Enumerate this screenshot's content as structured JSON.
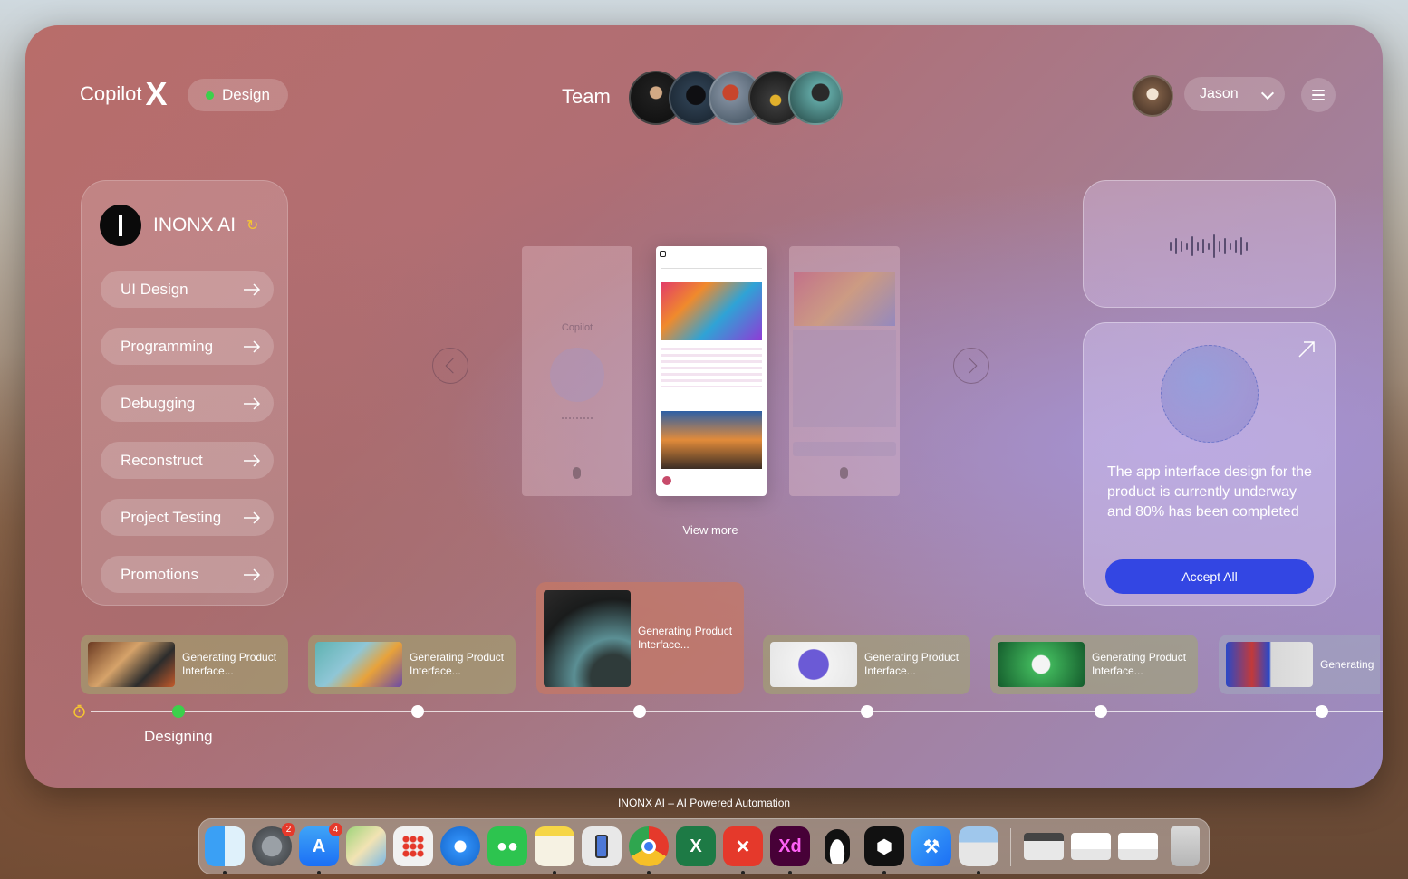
{
  "header": {
    "app_name": "Copilot",
    "app_name_suffix": "X",
    "mode_label": "Design",
    "team_label": "Team",
    "user_name": "Jason"
  },
  "sidebar": {
    "brand_name": "INONX AI",
    "items": [
      {
        "label": "UI Design"
      },
      {
        "label": "Programming"
      },
      {
        "label": "Debugging"
      },
      {
        "label": "Reconstruct"
      },
      {
        "label": "Project Testing"
      },
      {
        "label": "Promotions"
      }
    ]
  },
  "carousel": {
    "left_phone_title": "Copilot",
    "view_more_label": "View more"
  },
  "status_card": {
    "message": "The app interface design for the product is currently underway and 80% has been completed",
    "accept_label": "Accept All"
  },
  "tasks": [
    {
      "label": "Generating Product Interface..."
    },
    {
      "label": "Generating Product Interface..."
    },
    {
      "label": "Generating Product Interface..."
    },
    {
      "label": "Generating Product Interface..."
    },
    {
      "label": "Generating Product Interface..."
    },
    {
      "label": "Generating"
    }
  ],
  "timeline": {
    "current_stage_label": "Designing"
  },
  "dock": {
    "caption": "INONX AI – AI Powered Automation",
    "settings_badge": "2",
    "appstore_badge": "4",
    "icons": [
      "finder-icon",
      "settings-icon",
      "appstore-icon",
      "maps-icon",
      "launchpad-icon",
      "safari-icon",
      "wechat-icon",
      "notes-icon",
      "iphone-mirroring-icon",
      "chrome-icon",
      "excel-icon",
      "xmind-icon",
      "xd-icon",
      "qq-icon",
      "box-icon",
      "xcode-icon",
      "preview-icon",
      "window-icon",
      "xd-file-icon",
      "xd-file-icon",
      "trash-icon"
    ]
  },
  "colors": {
    "accent_blue": "#3346e3",
    "status_green": "#3bd14b",
    "refresh_yellow": "#f5c531"
  }
}
